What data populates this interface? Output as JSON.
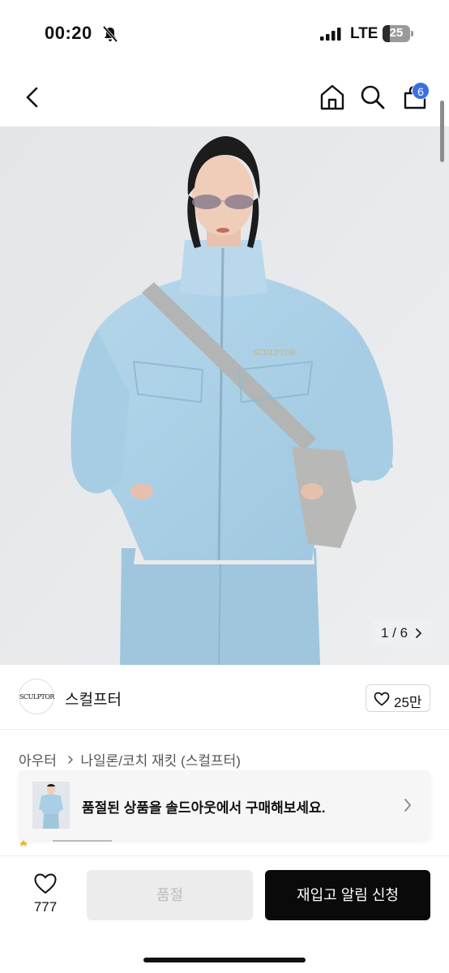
{
  "status_bar": {
    "time": "00:20",
    "network": "LTE",
    "battery": "25",
    "battery_level": 0.25
  },
  "nav": {
    "cart_count": "6"
  },
  "hero": {
    "counter": "1 / 6",
    "logo_text": "SCULPTOR"
  },
  "brand": {
    "logo_text": "SCULPTOR",
    "name": "스컬프터",
    "likes": "25만"
  },
  "breadcrumb": {
    "category": "아우터",
    "subcategory": "나일론/코치 재킷 (스컬프터)"
  },
  "soldout_banner": {
    "text": "품절된 상품을 솔드아웃에서 구매해보세요."
  },
  "bottom_bar": {
    "wish_count": "777",
    "soldout_label": "품절",
    "restock_label": "재입고 알림 신청"
  },
  "colors": {
    "accent_badge": "#3b6fe0",
    "primary_button": "#0a0a0a",
    "disabled_button": "#ececec"
  }
}
